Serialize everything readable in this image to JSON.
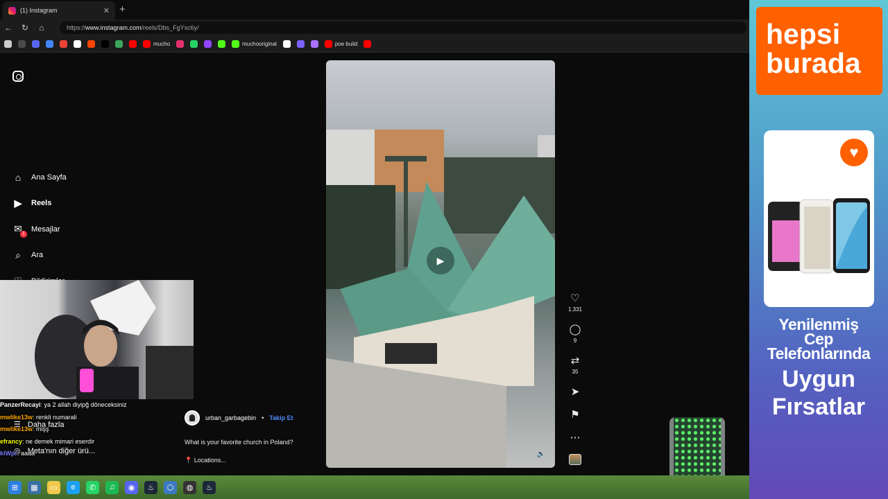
{
  "browser": {
    "tab_title": "(1) Instagram",
    "tab_close": "✕",
    "new_tab": "+",
    "url_prefix": "https://",
    "url_host": "www.instagram.com",
    "url_path": "/reels/Dbs_FgYsc6y/",
    "bookmarks": [
      {
        "label": "",
        "color": "#cccccc"
      },
      {
        "label": "",
        "color": "#4a4a4a"
      },
      {
        "label": "",
        "color": "#5865f2"
      },
      {
        "label": "",
        "color": "#4285f4"
      },
      {
        "label": "",
        "color": "#ea4335"
      },
      {
        "label": "",
        "color": "#ffffff"
      },
      {
        "label": "",
        "color": "#ff4500"
      },
      {
        "label": "",
        "color": "#000000"
      },
      {
        "label": "",
        "color": "#3ba55c"
      },
      {
        "label": "",
        "color": "#ff0000"
      },
      {
        "label": "mucho",
        "color": "#ff0000"
      },
      {
        "label": "",
        "color": "#e1306c"
      },
      {
        "label": "",
        "color": "#25d366"
      },
      {
        "label": "",
        "color": "#9146ff"
      },
      {
        "label": "",
        "color": "#53fc18"
      },
      {
        "label": "muchooriginal",
        "color": "#53fc18"
      },
      {
        "label": "",
        "color": "#ffffff"
      },
      {
        "label": "",
        "color": "#7b61ff"
      },
      {
        "label": "",
        "color": "#a970ff"
      },
      {
        "label": "poe build",
        "color": "#ff0000"
      },
      {
        "label": "",
        "color": "#ff0000"
      }
    ]
  },
  "nav": {
    "items": [
      {
        "label": "Ana Sayfa",
        "icon": "⌂"
      },
      {
        "label": "Reels",
        "icon": "▶"
      },
      {
        "label": "Mesajlar",
        "icon": "✉",
        "badge": "1"
      },
      {
        "label": "Ara",
        "icon": "⌕"
      },
      {
        "label": "Bildirimler",
        "icon": "♡"
      }
    ],
    "more_label": "Daha fazla",
    "meta_label": "Meta'nın diğer ürü..."
  },
  "reel": {
    "likes": "1.331",
    "comments": "9",
    "reposts": "35",
    "username": "urban_garbagebin",
    "separator": "•",
    "follow_label": "Takip Et",
    "caption": "What is your favorite church in Poland?",
    "location": "📍 Locations..."
  },
  "chat": [
    {
      "name": "PanzerRecayi",
      "text": ": ya 2 allah diyipğ döneceksiniz",
      "color": "#ffffff"
    },
    {
      "name": "mwlike13w",
      "text": ": renkli numarali",
      "color": "#ffa500"
    },
    {
      "name": "mwlike13w",
      "text": ": mişş",
      "color": "#ffa500"
    },
    {
      "name": "efrancy",
      "text": ": ne demek mimari eserdir",
      "color": "#f2ff00"
    },
    {
      "name": "kiWpr",
      "text": ": aaaa",
      "color": "#7b7bff"
    }
  ],
  "ad": {
    "brand_line1": "hepsi",
    "brand_line2": "burada",
    "headline_1": "Yenilenmiş",
    "headline_2": "Cep",
    "headline_3": "Telefonlarında",
    "cta_1": "Uygun",
    "cta_2": "Fırsatlar",
    "brand_color": "#ff6000"
  },
  "taskbar": {
    "icons": [
      "windows-start-icon",
      "widgets-icon",
      "file-explorer-icon",
      "edge-icon",
      "whatsapp-icon",
      "spotify-icon",
      "discord-icon",
      "steam-icon",
      "network-icon",
      "obs-icon",
      "steam-icon"
    ]
  }
}
